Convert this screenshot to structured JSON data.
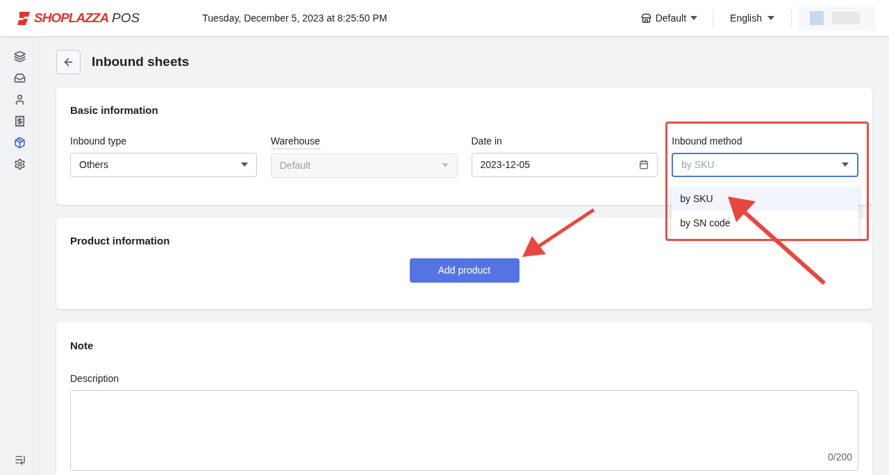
{
  "header": {
    "brand": "SHOPLAZZA",
    "product": "POS",
    "datetime": "Tuesday, December 5, 2023 at 8:25:50 PM",
    "store": "Default",
    "language": "English"
  },
  "sidebar": {
    "items": [
      {
        "kind": "cards",
        "selected": false
      },
      {
        "kind": "inbox",
        "selected": false
      },
      {
        "kind": "person",
        "selected": false
      },
      {
        "kind": "receipt",
        "selected": false
      },
      {
        "kind": "box",
        "selected": true
      },
      {
        "kind": "settings",
        "selected": false
      }
    ]
  },
  "page": {
    "title": "Inbound sheets"
  },
  "basic": {
    "title": "Basic information",
    "fields": [
      {
        "kind": "select",
        "label": "Inbound type",
        "value": "Others",
        "disabled": false
      },
      {
        "kind": "select",
        "label": "Warehouse",
        "value": "Default",
        "disabled": true
      },
      {
        "kind": "date",
        "label": "Date in",
        "value": "2023-12-05"
      },
      {
        "kind": "select",
        "label": "Inbound method",
        "placeholder": "by SKU",
        "disabled": false,
        "expanded": true,
        "options": [
          {
            "label": "by SKU",
            "selected": true
          },
          {
            "label": "by SN code",
            "selected": false
          }
        ]
      }
    ]
  },
  "product": {
    "title": "Product information",
    "button": "Add product"
  },
  "note": {
    "title": "Note",
    "label": "Description",
    "counter": "0/200"
  }
}
